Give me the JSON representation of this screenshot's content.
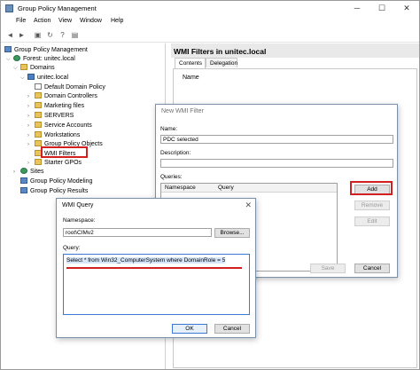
{
  "window": {
    "title": "Group Policy Management"
  },
  "menu": [
    "File",
    "Action",
    "View",
    "Window",
    "Help"
  ],
  "toolbar": {
    "icons": [
      "back-arrow-icon",
      "forward-arrow-icon",
      "folder-up-icon",
      "refresh-icon",
      "help-icon",
      "properties-icon"
    ]
  },
  "tree": {
    "root": "Group Policy Management",
    "forest": "Forest: unitec.local",
    "domains": "Domains",
    "domain": "unitec.local",
    "items": [
      "Default Domain Policy",
      "Domain Controllers",
      "Marketing files",
      "SERVERS",
      "Service Accounts",
      "Workstations",
      "Group Policy Objects",
      "WMI Filters",
      "Starter GPOs"
    ],
    "sites": "Sites",
    "modeling": "Group Policy Modeling",
    "results": "Group Policy Results"
  },
  "right_pane": {
    "title": "WMI Filters in unitec.local",
    "tabs": [
      "Contents",
      "Delegation"
    ],
    "column_name": "Name"
  },
  "new_wmi_filter": {
    "title": "New WMI Filter",
    "name_label": "Name:",
    "name_value": "PDC selected",
    "description_label": "Description:",
    "description_value": "",
    "queries_label": "Queries:",
    "col_namespace": "Namespace",
    "col_query": "Query",
    "add_button": "Add",
    "remove_button": "Remove",
    "edit_button": "Edit",
    "save_button": "Save",
    "cancel_button": "Cancel"
  },
  "wmi_query": {
    "title": "WMI Query",
    "namespace_label": "Namespace:",
    "namespace_value": "root\\CIMv2",
    "browse_button": "Browse...",
    "query_label": "Query:",
    "query_value": "Select * from Win32_ComputerSystem where DomainRole = 5",
    "ok_button": "OK",
    "cancel_button": "Cancel"
  },
  "colors": {
    "highlight_red": "#d21f1f",
    "selection_blue": "#d6e6fa"
  }
}
